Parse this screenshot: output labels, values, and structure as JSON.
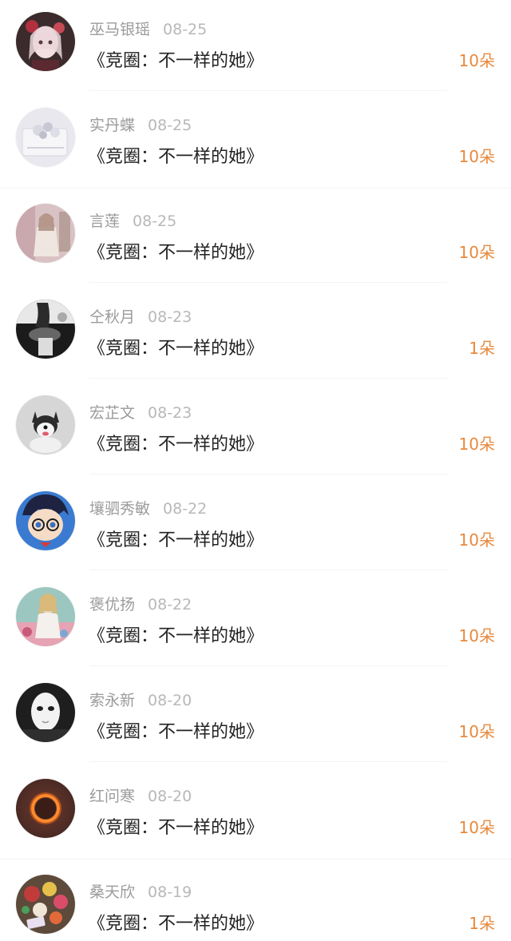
{
  "items": [
    {
      "name": "巫马银瑶",
      "date": "08-25",
      "title": "《竞圈：不一样的她》",
      "gift": "10朵",
      "avatar_icon": "avatar-doll-girl"
    },
    {
      "name": "实丹蝶",
      "date": "08-25",
      "title": "《竞圈：不一样的她》",
      "gift": "10朵",
      "avatar_icon": "avatar-flowers-bag"
    },
    {
      "name": "言莲",
      "date": "08-25",
      "title": "《竞圈：不一样的她》",
      "gift": "10朵",
      "avatar_icon": "avatar-doll-room"
    },
    {
      "name": "仝秋月",
      "date": "08-23",
      "title": "《竞圈：不一样的她》",
      "gift": "1朵",
      "avatar_icon": "avatar-bw-girl"
    },
    {
      "name": "宏芷文",
      "date": "08-23",
      "title": "《竞圈：不一样的她》",
      "gift": "10朵",
      "avatar_icon": "avatar-husky-dog"
    },
    {
      "name": "壤驷秀敏",
      "date": "08-22",
      "title": "《竞圈：不一样的她》",
      "gift": "10朵",
      "avatar_icon": "avatar-anime-boy"
    },
    {
      "name": "褒优扬",
      "date": "08-22",
      "title": "《竞圈：不一样的她》",
      "gift": "10朵",
      "avatar_icon": "avatar-painting-woman"
    },
    {
      "name": "索永新",
      "date": "08-20",
      "title": "《竞圈：不一样的她》",
      "gift": "10朵",
      "avatar_icon": "avatar-white-mask"
    },
    {
      "name": "红问寒",
      "date": "08-20",
      "title": "《竞圈：不一样的她》",
      "gift": "10朵",
      "avatar_icon": "avatar-eclipse"
    },
    {
      "name": "桑天欣",
      "date": "08-19",
      "title": "《竞圈：不一样的她》",
      "gift": "1朵",
      "avatar_icon": "avatar-flower-bouquet"
    }
  ],
  "colors": {
    "gift": "#e8893c",
    "name": "#9b9b9b",
    "date": "#b8b8b8",
    "title": "#222222"
  }
}
